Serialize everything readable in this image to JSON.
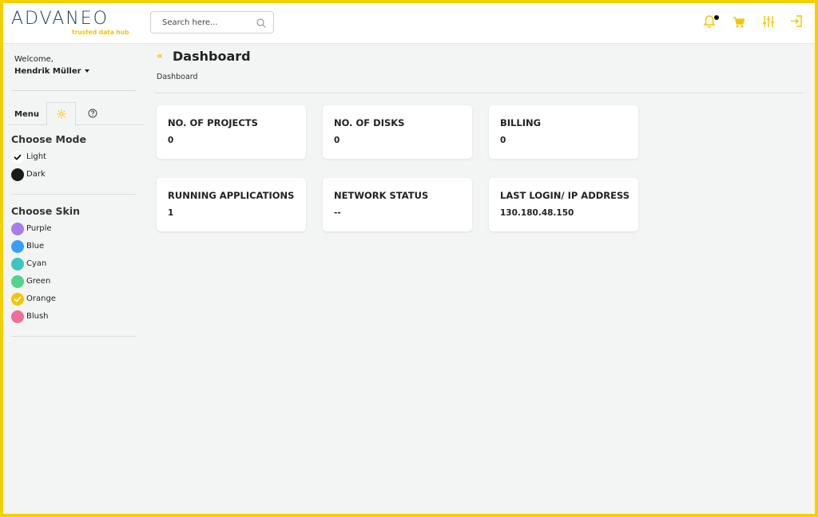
{
  "header": {
    "logo_text": "ADVANEO",
    "logo_tagline": "trusted data hub",
    "search_placeholder": "Search here...",
    "icons": [
      "bell-icon",
      "cart-icon",
      "sliders-icon",
      "sign-in-icon"
    ]
  },
  "colors": {
    "accent": "#f5c400",
    "frame": "#f5d000",
    "logo": "#1e3a5a"
  },
  "sidebar": {
    "welcome": "Welcome,",
    "username": "Hendrik Müller",
    "tabs": {
      "menu": "Menu"
    },
    "mode": {
      "title": "Choose Mode",
      "options": [
        {
          "label": "Light",
          "color": "#ffffff",
          "selected": true
        },
        {
          "label": "Dark",
          "color": "#1a1a1a",
          "selected": false
        }
      ]
    },
    "skin": {
      "title": "Choose Skin",
      "options": [
        {
          "label": "Purple",
          "color": "#a57ee8",
          "selected": false
        },
        {
          "label": "Blue",
          "color": "#3aa0f5",
          "selected": false
        },
        {
          "label": "Cyan",
          "color": "#3cc6c0",
          "selected": false
        },
        {
          "label": "Green",
          "color": "#52d38b",
          "selected": false
        },
        {
          "label": "Orange",
          "color": "#f5c400",
          "selected": true
        },
        {
          "label": "Blush",
          "color": "#ec6f9c",
          "selected": false
        }
      ]
    }
  },
  "main": {
    "title": "Dashboard",
    "breadcrumb": "Dashboard",
    "cards": [
      {
        "title": "NO. OF PROJECTS",
        "value": "0"
      },
      {
        "title": "NO. OF DISKS",
        "value": "0"
      },
      {
        "title": "BILLING",
        "value": "0"
      },
      {
        "title": "RUNNING APPLICATIONS",
        "value": "1"
      },
      {
        "title": "NETWORK STATUS",
        "value": "--"
      },
      {
        "title": "LAST LOGIN/ IP ADDRESS",
        "value": "130.180.48.150"
      }
    ]
  }
}
